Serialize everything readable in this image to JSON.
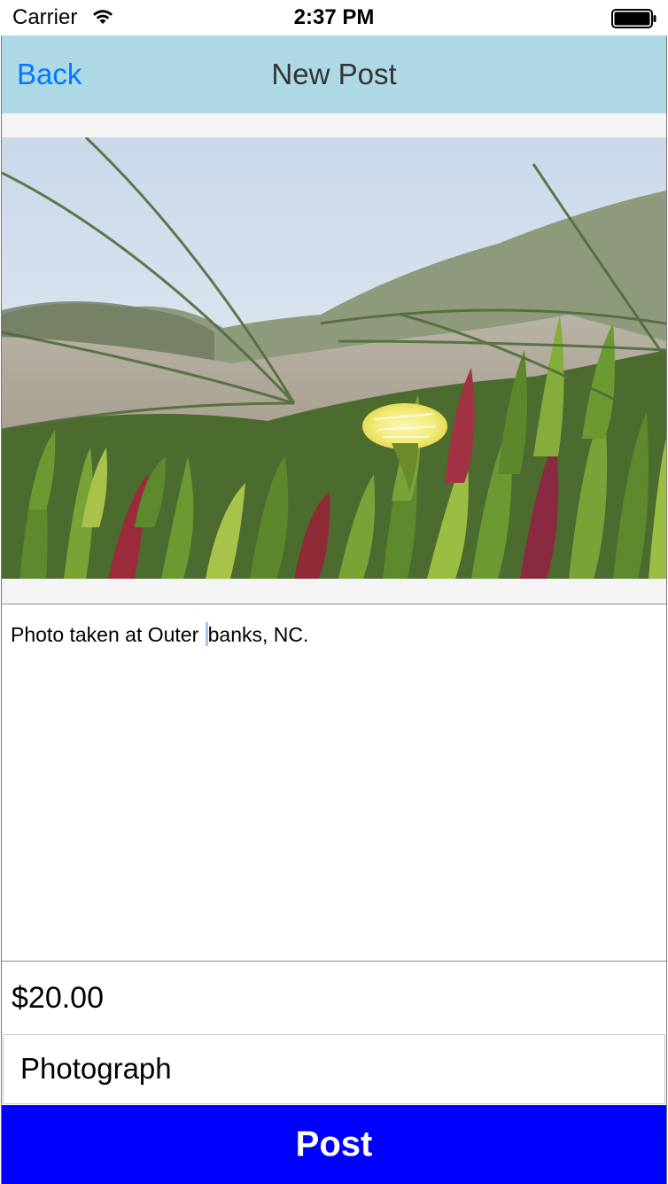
{
  "status_bar": {
    "carrier": "Carrier",
    "time": "2:37 PM",
    "wifi_icon": "wifi-icon",
    "battery_icon": "battery-icon"
  },
  "nav": {
    "back_label": "Back",
    "title": "New Post",
    "background": "#add8e6",
    "back_color": "#007aff"
  },
  "photo": {
    "description": "post-photo"
  },
  "post": {
    "description_before_caret": "Photo taken at Outer ",
    "description_after_caret": "banks, NC.",
    "price": "$20.00",
    "category": "Photograph"
  },
  "post_button": {
    "label": "Post",
    "background": "#0000ff"
  }
}
